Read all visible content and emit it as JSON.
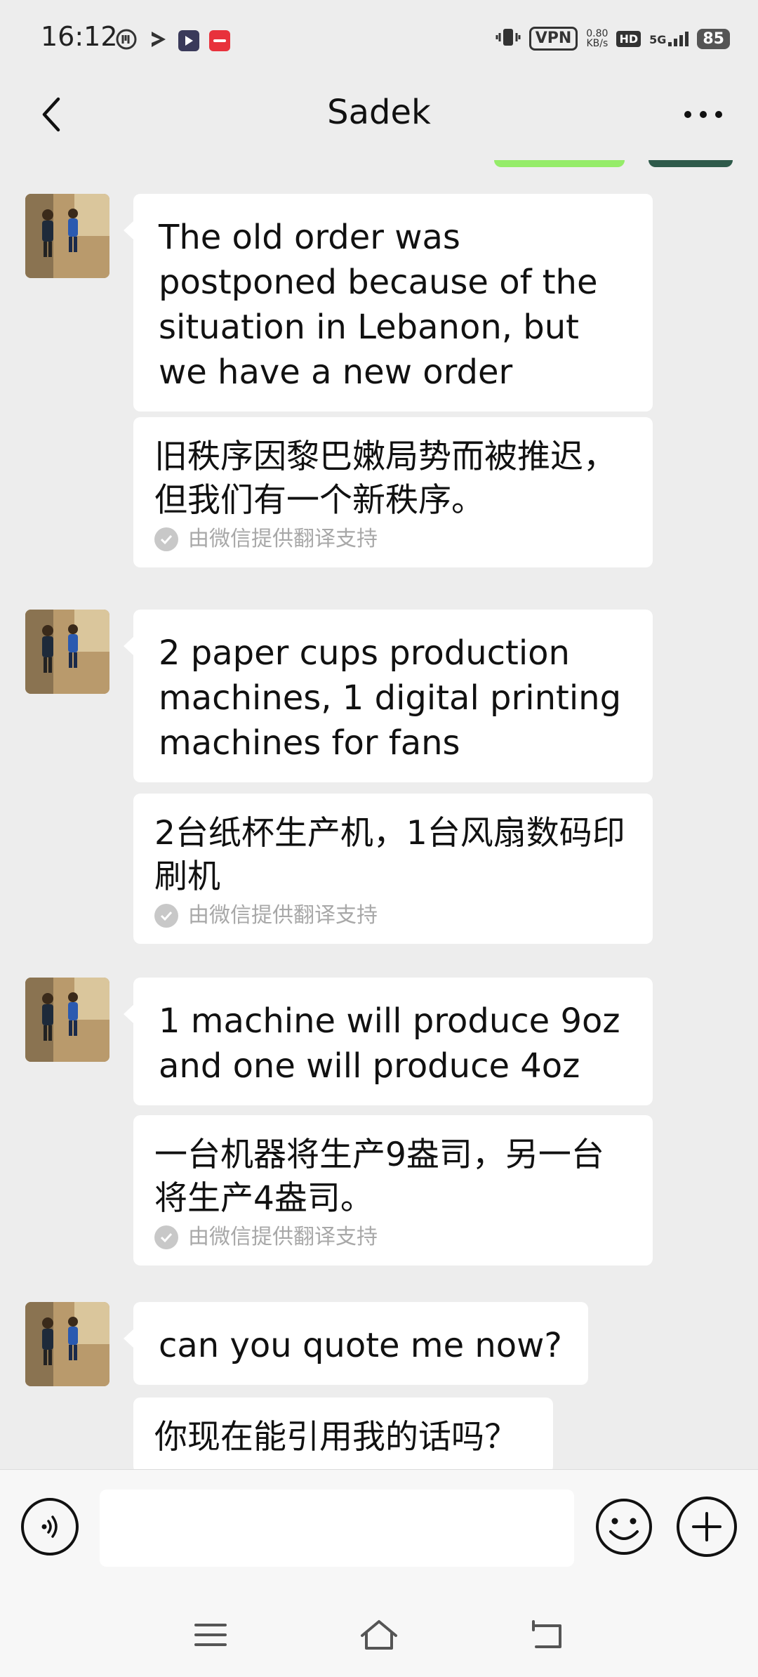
{
  "status_bar": {
    "time": "16:12",
    "vpn_label": "VPN",
    "speed_value": "0.80",
    "speed_unit": "KB/s",
    "hd_label": "HD",
    "network": "5G",
    "battery": "85"
  },
  "header": {
    "title": "Sadek"
  },
  "messages": [
    {
      "text": "The old order was postponed because of the situation in Lebanon, but we have a new order",
      "translation": "旧秩序因黎巴嫩局势而被推迟，但我们有一个新秩序。",
      "translation_note": "由微信提供翻译支持"
    },
    {
      "text": "2 paper cups production machines, 1 digital printing machines for fans",
      "translation": "2台纸杯生产机，1台风扇数码印刷机",
      "translation_note": "由微信提供翻译支持"
    },
    {
      "text": "1 machine will produce 9oz and one will produce 4oz",
      "translation": "一台机器将生产9盎司，另一台将生产4盎司。",
      "translation_note": "由微信提供翻译支持"
    },
    {
      "text": "can you quote me now?",
      "translation": "你现在能引用我的话吗？"
    }
  ],
  "input_bar": {
    "placeholder": ""
  },
  "colors": {
    "chat_background": "#ededed",
    "bubble_background": "#ffffff",
    "translation_note": "#a8a8a8",
    "sent_bubble_accent": "#95ec69"
  },
  "icons": {
    "back": "chevron-left-icon",
    "more": "more-dots-icon",
    "voice": "voice-icon",
    "emoji": "emoji-icon",
    "plus": "plus-icon",
    "nav_menu": "menu-icon",
    "nav_home": "home-icon",
    "nav_back": "back-arrow-icon"
  }
}
